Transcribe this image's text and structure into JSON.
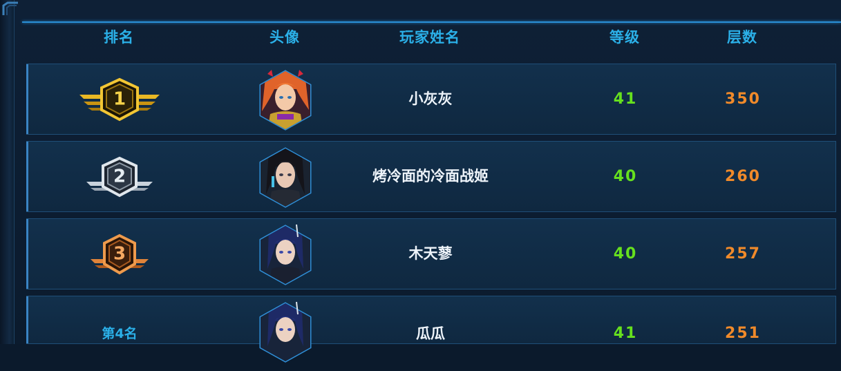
{
  "headers": {
    "rank": "排名",
    "avatar": "头像",
    "player_name": "玩家姓名",
    "level": "等级",
    "floors": "层数"
  },
  "rows": [
    {
      "rank": "1",
      "rank_style": "gold",
      "avatar": "orange-hair-heroine-portrait-icon",
      "name": "小灰灰",
      "level": "41",
      "floors": "350"
    },
    {
      "rank": "2",
      "rank_style": "silver",
      "avatar": "black-hair-heroine-portrait-icon",
      "name": "烤冷面的冷面战姬",
      "level": "40",
      "floors": "260"
    },
    {
      "rank": "3",
      "rank_style": "bronze",
      "avatar": "blue-hair-heroine-portrait-icon",
      "name": "木天蓼",
      "level": "40",
      "floors": "257"
    },
    {
      "rank": "第4名",
      "rank_style": "text",
      "avatar": "blue-hair-heroine-portrait-icon",
      "name": "瓜瓜",
      "level": "41",
      "floors": "251"
    }
  ],
  "colors": {
    "header_text": "#2bb0e8",
    "level_text": "#66e01e",
    "floors_text": "#f08a2a",
    "name_text": "#eef4fa",
    "gold": "#e9b824",
    "silver": "#c9d3dc",
    "bronze": "#d9782e"
  }
}
